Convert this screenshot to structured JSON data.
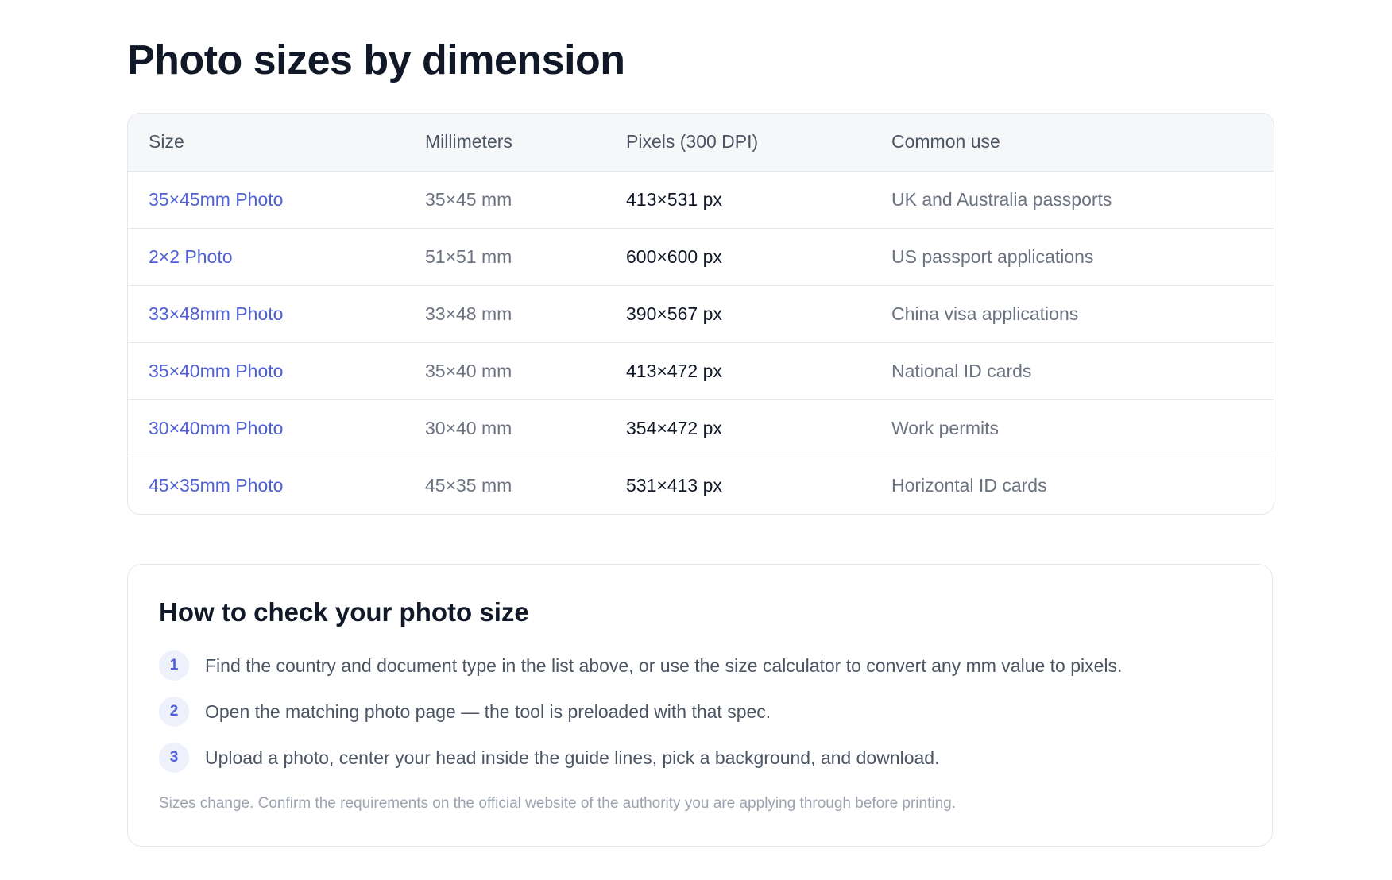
{
  "page": {
    "title": "Photo sizes by dimension"
  },
  "table": {
    "headers": {
      "size": "Size",
      "millimeters": "Millimeters",
      "pixels": "Pixels (300 DPI)",
      "use": "Common use"
    },
    "rows": [
      {
        "size": "35×45mm Photo",
        "mm": "35×45 mm",
        "px": "413×531 px",
        "use": "UK and Australia passports"
      },
      {
        "size": "2×2 Photo",
        "mm": "51×51 mm",
        "px": "600×600 px",
        "use": "US passport applications"
      },
      {
        "size": "33×48mm Photo",
        "mm": "33×48 mm",
        "px": "390×567 px",
        "use": "China visa applications"
      },
      {
        "size": "35×40mm Photo",
        "mm": "35×40 mm",
        "px": "413×472 px",
        "use": "National ID cards"
      },
      {
        "size": "30×40mm Photo",
        "mm": "30×40 mm",
        "px": "354×472 px",
        "use": "Work permits"
      },
      {
        "size": "45×35mm Photo",
        "mm": "45×35 mm",
        "px": "531×413 px",
        "use": "Horizontal ID cards"
      }
    ]
  },
  "howto": {
    "title": "How to check your photo size",
    "steps": [
      {
        "num": "1",
        "text": "Find the country and document type in the list above, or use the size calculator to convert any mm value to pixels."
      },
      {
        "num": "2",
        "text": "Open the matching photo page — the tool is preloaded with that spec."
      },
      {
        "num": "3",
        "text": "Upload a photo, center your head inside the guide lines, pick a background, and download."
      }
    ],
    "note": "Sizes change. Confirm the requirements on the official website of the authority you are applying through before printing."
  },
  "colors": {
    "link": "#4f5fd6",
    "heading": "#111827",
    "muted_text": "#6b7280",
    "border": "#e5e7eb",
    "header_bg": "#f6f7f9",
    "step_badge_bg": "#eef0fb"
  }
}
